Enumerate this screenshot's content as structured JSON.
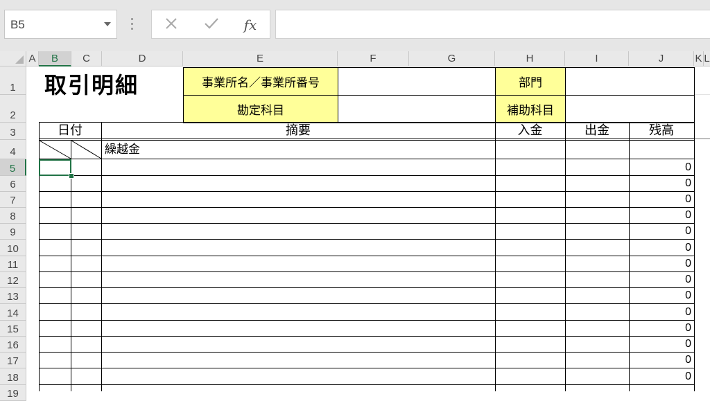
{
  "formula_bar": {
    "name_box": "B5",
    "cancel_icon": "cross-icon",
    "enter_icon": "check-icon",
    "fx_label": "fx",
    "formula": ""
  },
  "columns": [
    "A",
    "B",
    "C",
    "D",
    "E",
    "F",
    "G",
    "H",
    "I",
    "J",
    "K",
    "L"
  ],
  "selected_column": "B",
  "rows": [
    "1",
    "2",
    "3",
    "4",
    "5",
    "6",
    "7",
    "8",
    "9",
    "10",
    "11",
    "12",
    "13",
    "14",
    "15",
    "16",
    "17",
    "18",
    "19"
  ],
  "selected_row": "5",
  "sheet": {
    "title": "取引明細",
    "label_office": "事業所名／事業所番号",
    "label_account": "勘定科目",
    "label_department": "部門",
    "label_sub_account": "補助科目",
    "header_date": "日付",
    "header_summary": "摘要",
    "header_deposit": "入金",
    "header_withdrawal": "出金",
    "header_balance": "残高",
    "carryover_label": "繰越金",
    "balances": [
      "0",
      "0",
      "0",
      "0",
      "0",
      "0",
      "0",
      "0",
      "0",
      "0",
      "0",
      "0",
      "0",
      "0"
    ]
  },
  "colors": {
    "highlight_yellow": "#ffff99",
    "selection_green": "#217346"
  }
}
